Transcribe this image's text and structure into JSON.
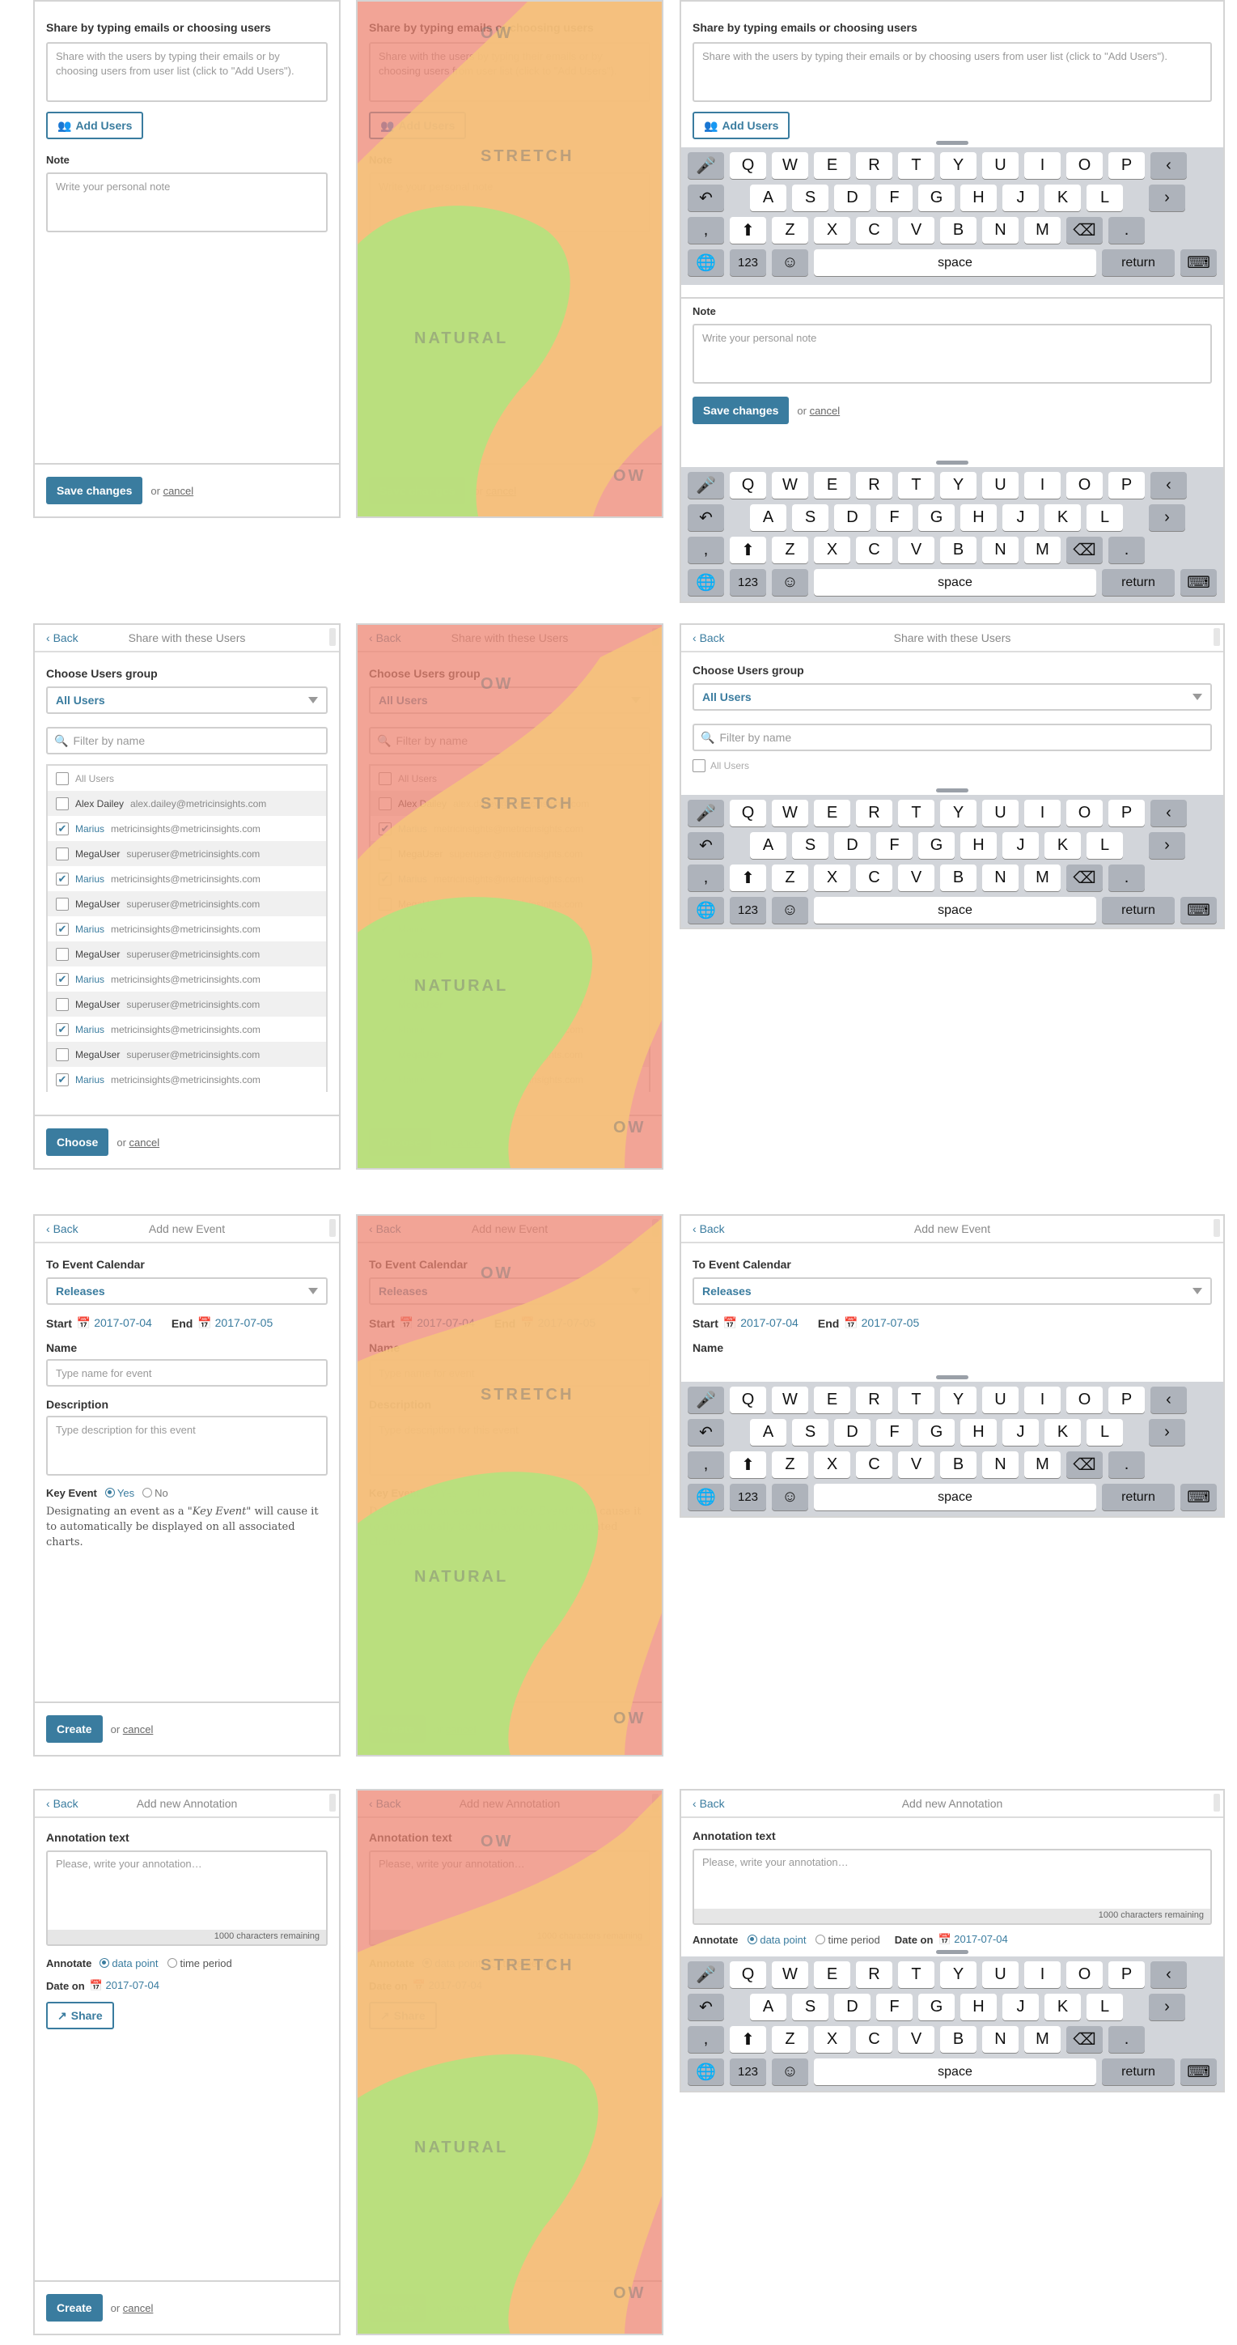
{
  "share_notes": {
    "share_label": "Share by typing emails or choosing users",
    "share_placeholder": "Share with the users by typing their emails or by choosing users from user list (click to \"Add Users\").",
    "add_users": "Add Users",
    "note_label": "Note",
    "note_placeholder": "Write your personal note",
    "save": "Save changes",
    "or": "or",
    "cancel": "cancel"
  },
  "share_users": {
    "back": "Back",
    "title": "Share with these Users",
    "group_label": "Choose Users group",
    "group_value": "All Users",
    "filter_placeholder": "Filter by name",
    "all_users": "All Users",
    "users": [
      {
        "name": "Alex Dailey",
        "email": "alex.dailey@metricinsights.com",
        "checked": false
      },
      {
        "name": "Marius",
        "email": "metricinsights@metricinsights.com",
        "checked": true
      },
      {
        "name": "MegaUser",
        "email": "superuser@metricinsights.com",
        "checked": false
      },
      {
        "name": "Marius",
        "email": "metricinsights@metricinsights.com",
        "checked": true
      },
      {
        "name": "MegaUser",
        "email": "superuser@metricinsights.com",
        "checked": false
      },
      {
        "name": "Marius",
        "email": "metricinsights@metricinsights.com",
        "checked": true
      },
      {
        "name": "MegaUser",
        "email": "superuser@metricinsights.com",
        "checked": false
      },
      {
        "name": "Marius",
        "email": "metricinsights@metricinsights.com",
        "checked": true
      },
      {
        "name": "MegaUser",
        "email": "superuser@metricinsights.com",
        "checked": false
      },
      {
        "name": "Marius",
        "email": "metricinsights@metricinsights.com",
        "checked": true
      },
      {
        "name": "MegaUser",
        "email": "superuser@metricinsights.com",
        "checked": false
      },
      {
        "name": "Marius",
        "email": "metricinsights@metricinsights.com",
        "checked": true
      }
    ],
    "choose": "Choose"
  },
  "event": {
    "back": "Back",
    "title": "Add new Event",
    "calendar_label": "To Event Calendar",
    "calendar_value": "Releases",
    "start_label": "Start",
    "start_value": "2017-07-04",
    "end_label": "End",
    "end_value": "2017-07-05",
    "name_label": "Name",
    "name_placeholder": "Type name for event",
    "desc_label": "Description",
    "desc_placeholder": "Type description for this event",
    "key_label": "Key Event",
    "yes": "Yes",
    "no": "No",
    "help_a": "Designating an event as a ",
    "help_b": "\"Key Event\"",
    "help_c": " will cause it to automatically be displayed on all associated charts.",
    "create": "Create"
  },
  "annotation": {
    "back": "Back",
    "title": "Add new Annotation",
    "text_label": "Annotation text",
    "text_placeholder": "Please, write your annotation…",
    "remaining": "1000 characters remaining",
    "annotate_label": "Annotate",
    "opt_point": "data point",
    "opt_period": "time period",
    "date_label": "Date on",
    "date_value": "2017-07-04",
    "share": "Share",
    "create": "Create"
  },
  "keyboard": {
    "row1": [
      "Q",
      "W",
      "E",
      "R",
      "T",
      "Y",
      "U",
      "I",
      "O",
      "P"
    ],
    "row2": [
      "A",
      "S",
      "D",
      "F",
      "G",
      "H",
      "J",
      "K",
      "L"
    ],
    "row3": [
      "Z",
      "X",
      "C",
      "V",
      "B",
      "N",
      "M"
    ],
    "num": "123",
    "space": "space",
    "return": "return",
    "comma": ",",
    "period": "."
  },
  "overlay": {
    "stretch": "STRETCH",
    "natural": "NATURAL",
    "ow": "OW"
  },
  "colors": {
    "accent": "#3a7c9f",
    "heat_red": "#ee8573",
    "heat_yellow": "#f6c67a",
    "heat_green": "#b4e27e"
  }
}
